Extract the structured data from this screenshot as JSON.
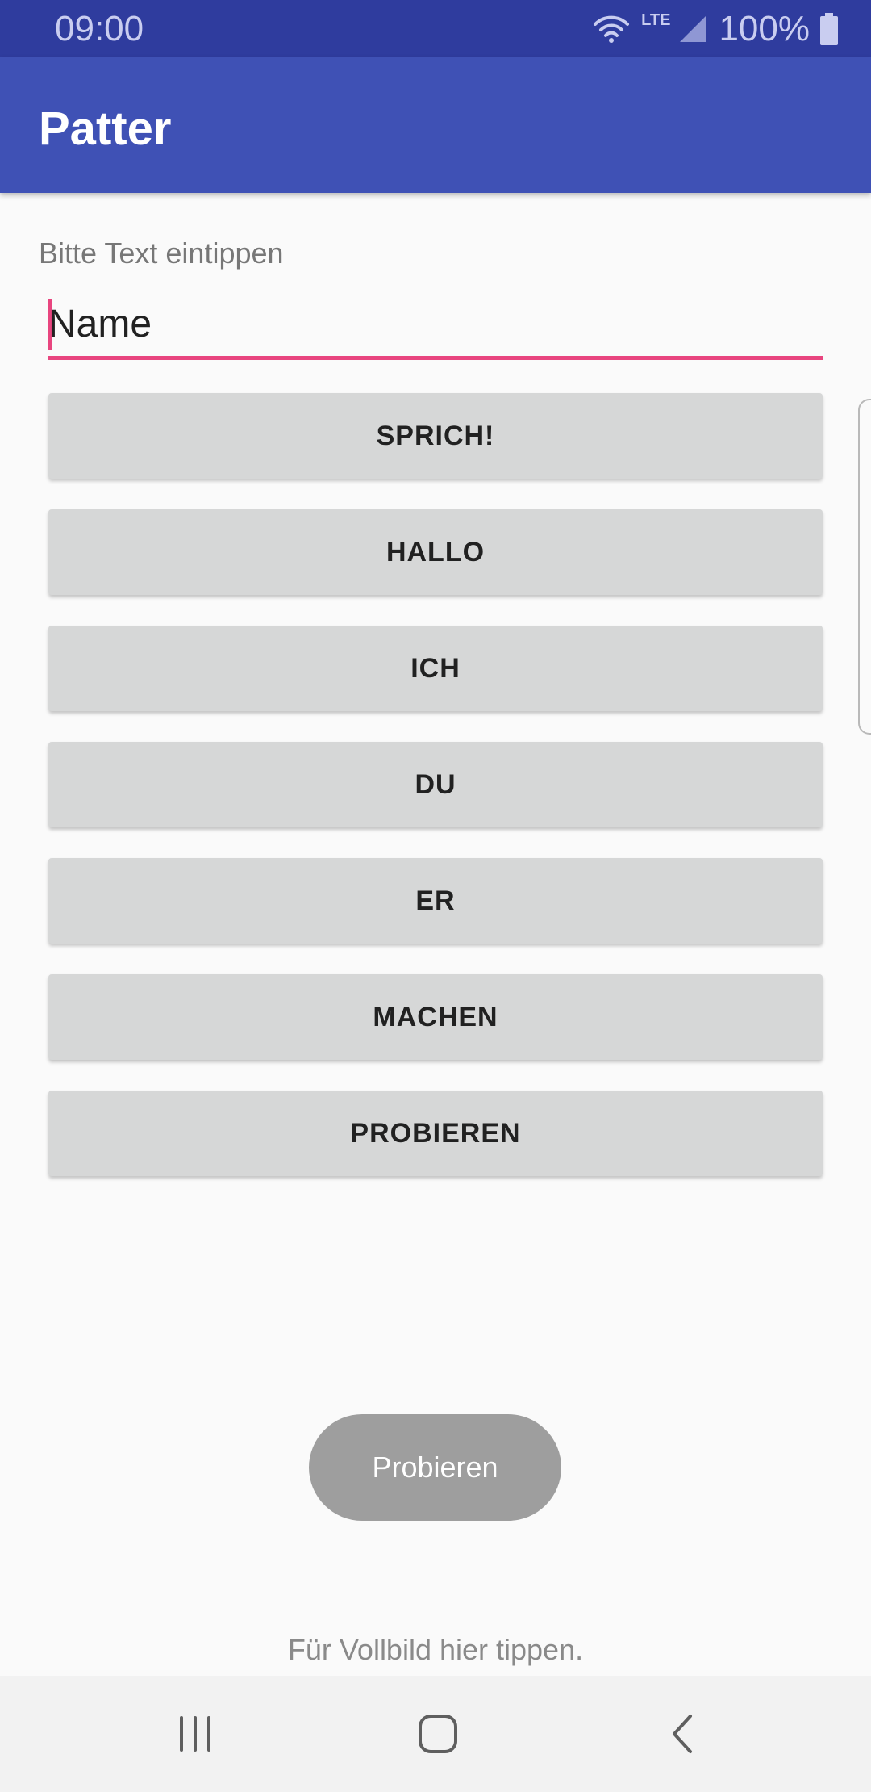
{
  "status_bar": {
    "time": "09:00",
    "network": "LTE",
    "battery": "100%",
    "icons": [
      "wifi-icon",
      "signal-icon",
      "battery-icon"
    ]
  },
  "app_bar": {
    "title": "Patter"
  },
  "input": {
    "hint": "Bitte Text eintippen",
    "value": "Name"
  },
  "buttons": [
    "SPRICH!",
    "HALLO",
    "ICH",
    "DU",
    "ER",
    "MACHEN",
    "PROBIEREN"
  ],
  "toast": {
    "text": "Probieren"
  },
  "footer": {
    "text": "Für Vollbild hier tippen."
  },
  "nav_bar": {
    "icons": [
      "recents-icon",
      "home-icon",
      "back-icon"
    ]
  },
  "colors": {
    "status_bar": "#2f3c9e",
    "app_bar": "#3f51b5",
    "accent": "#e8457f",
    "button": "#d6d7d7",
    "toast": "#9e9e9e"
  }
}
